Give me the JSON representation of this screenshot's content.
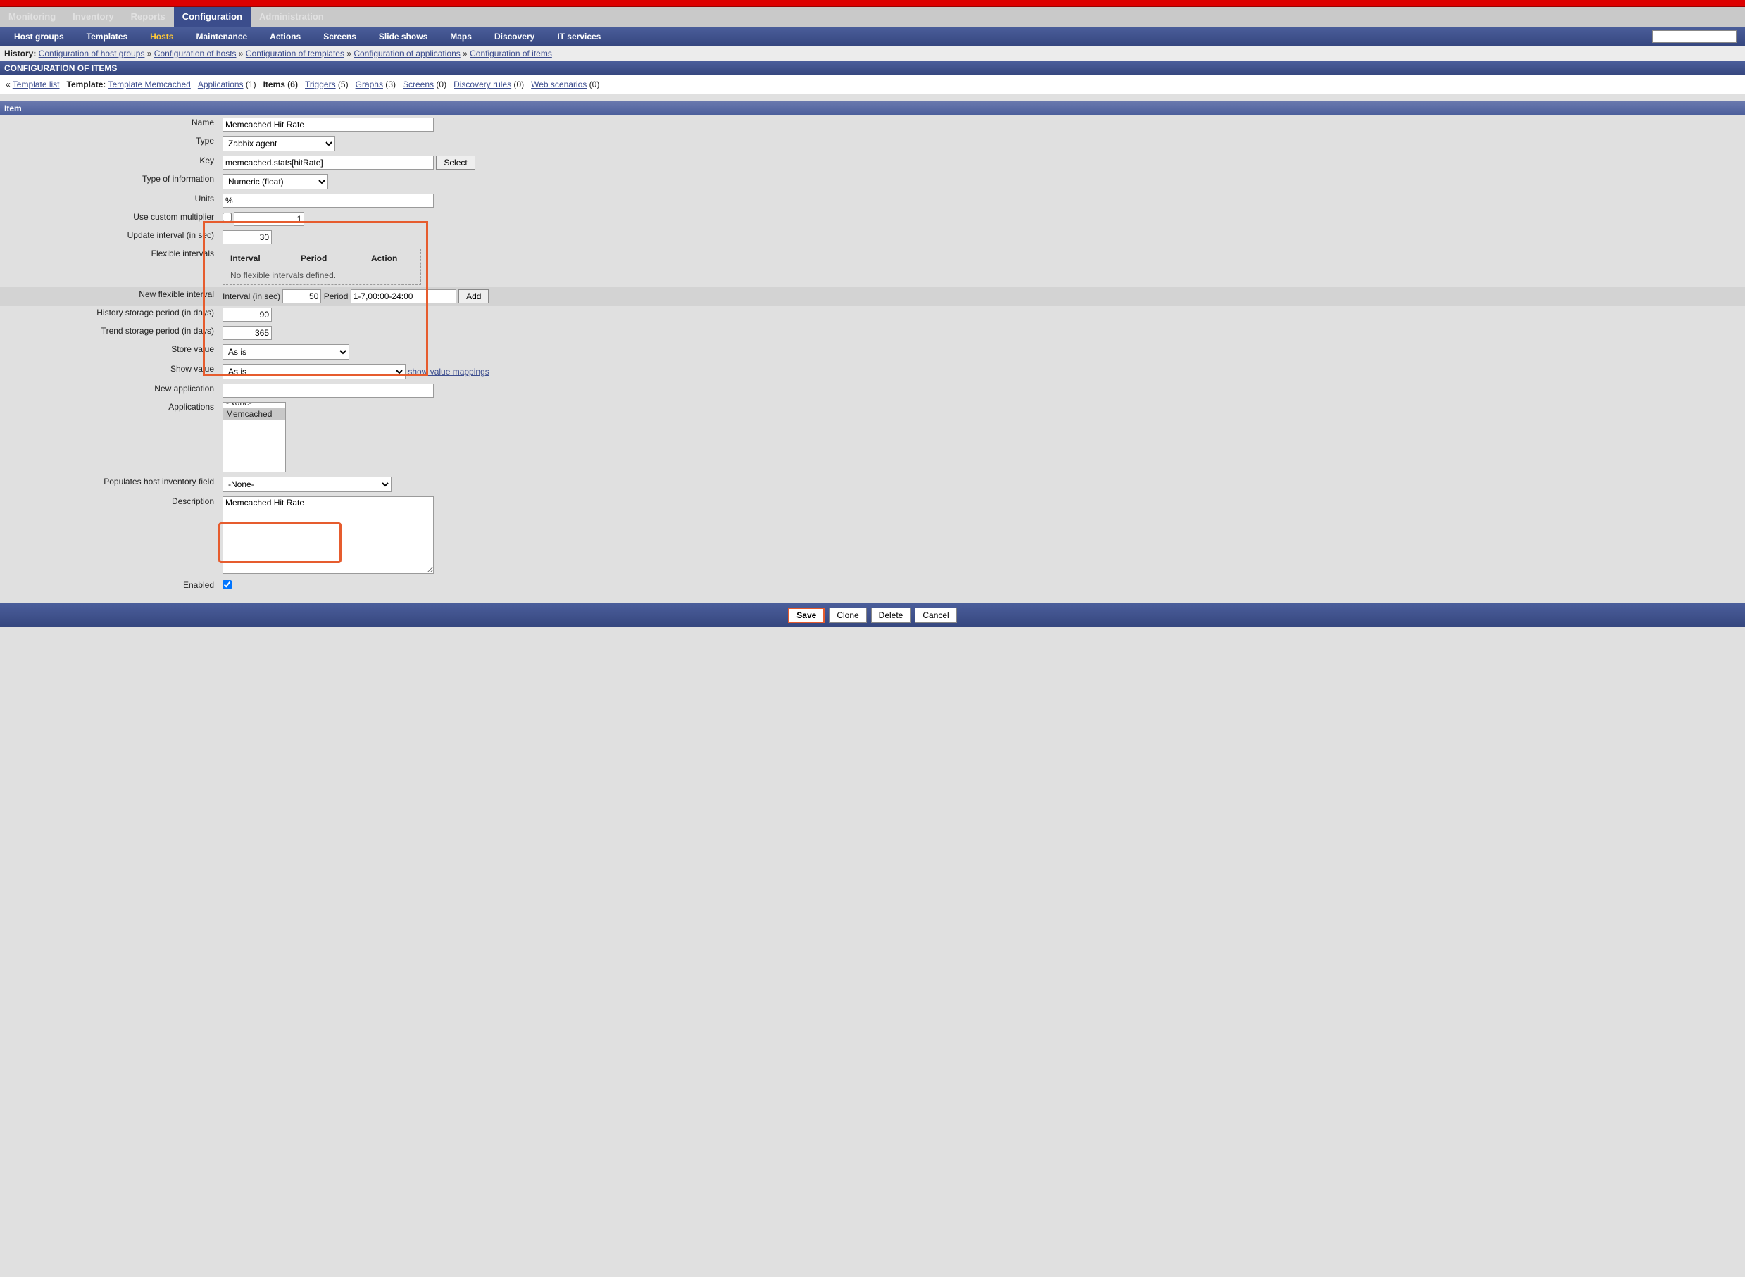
{
  "mainnav": {
    "items": [
      "Monitoring",
      "Inventory",
      "Reports",
      "Configuration",
      "Administration"
    ],
    "active": "Configuration"
  },
  "subnav": {
    "items": [
      "Host groups",
      "Templates",
      "Hosts",
      "Maintenance",
      "Actions",
      "Screens",
      "Slide shows",
      "Maps",
      "Discovery",
      "IT services"
    ],
    "active": "Hosts"
  },
  "history": {
    "label": "History:",
    "items": [
      "Configuration of host groups",
      "Configuration of hosts",
      "Configuration of templates",
      "Configuration of applications",
      "Configuration of items"
    ]
  },
  "pageTitle": "CONFIGURATION OF ITEMS",
  "crumb": {
    "back": "« ",
    "templateList": "Template list",
    "templateLabel": "Template:",
    "templateName": "Template Memcached",
    "links": [
      {
        "label": "Applications",
        "count": 1,
        "link": true
      },
      {
        "label": "Items",
        "count": 6,
        "link": false
      },
      {
        "label": "Triggers",
        "count": 5,
        "link": true
      },
      {
        "label": "Graphs",
        "count": 3,
        "link": true
      },
      {
        "label": "Screens",
        "count": 0,
        "link": true
      },
      {
        "label": "Discovery rules",
        "count": 0,
        "link": true
      },
      {
        "label": "Web scenarios",
        "count": 0,
        "link": true
      }
    ]
  },
  "section": "Item",
  "form": {
    "name": {
      "label": "Name",
      "value": "Memcached Hit Rate"
    },
    "type": {
      "label": "Type",
      "value": "Zabbix agent"
    },
    "key": {
      "label": "Key",
      "value": "memcached.stats[hitRate]",
      "select": "Select"
    },
    "info": {
      "label": "Type of information",
      "value": "Numeric (float)"
    },
    "units": {
      "label": "Units",
      "value": "%"
    },
    "multiplier": {
      "label": "Use custom multiplier",
      "checked": false,
      "value": "1"
    },
    "update": {
      "label": "Update interval (in sec)",
      "value": "30"
    },
    "flex": {
      "label": "Flexible intervals",
      "hdr": [
        "Interval",
        "Period",
        "Action"
      ],
      "empty": "No flexible intervals defined."
    },
    "newflex": {
      "label": "New flexible interval",
      "intervalLabel": "Interval (in sec)",
      "interval": "50",
      "periodLabel": "Period",
      "period": "1-7,00:00-24:00",
      "add": "Add"
    },
    "history": {
      "label": "History storage period (in days)",
      "value": "90"
    },
    "trend": {
      "label": "Trend storage period (in days)",
      "value": "365"
    },
    "store": {
      "label": "Store value",
      "value": "As is"
    },
    "show": {
      "label": "Show value",
      "value": "As is",
      "link": "show value mappings"
    },
    "newapp": {
      "label": "New application",
      "value": ""
    },
    "apps": {
      "label": "Applications",
      "options": [
        "-None-",
        "Memcached"
      ],
      "selected": "Memcached"
    },
    "inv": {
      "label": "Populates host inventory field",
      "value": "-None-"
    },
    "desc": {
      "label": "Description",
      "value": "Memcached Hit Rate"
    },
    "enabled": {
      "label": "Enabled",
      "checked": true
    }
  },
  "actions": {
    "save": "Save",
    "clone": "Clone",
    "delete": "Delete",
    "cancel": "Cancel"
  }
}
